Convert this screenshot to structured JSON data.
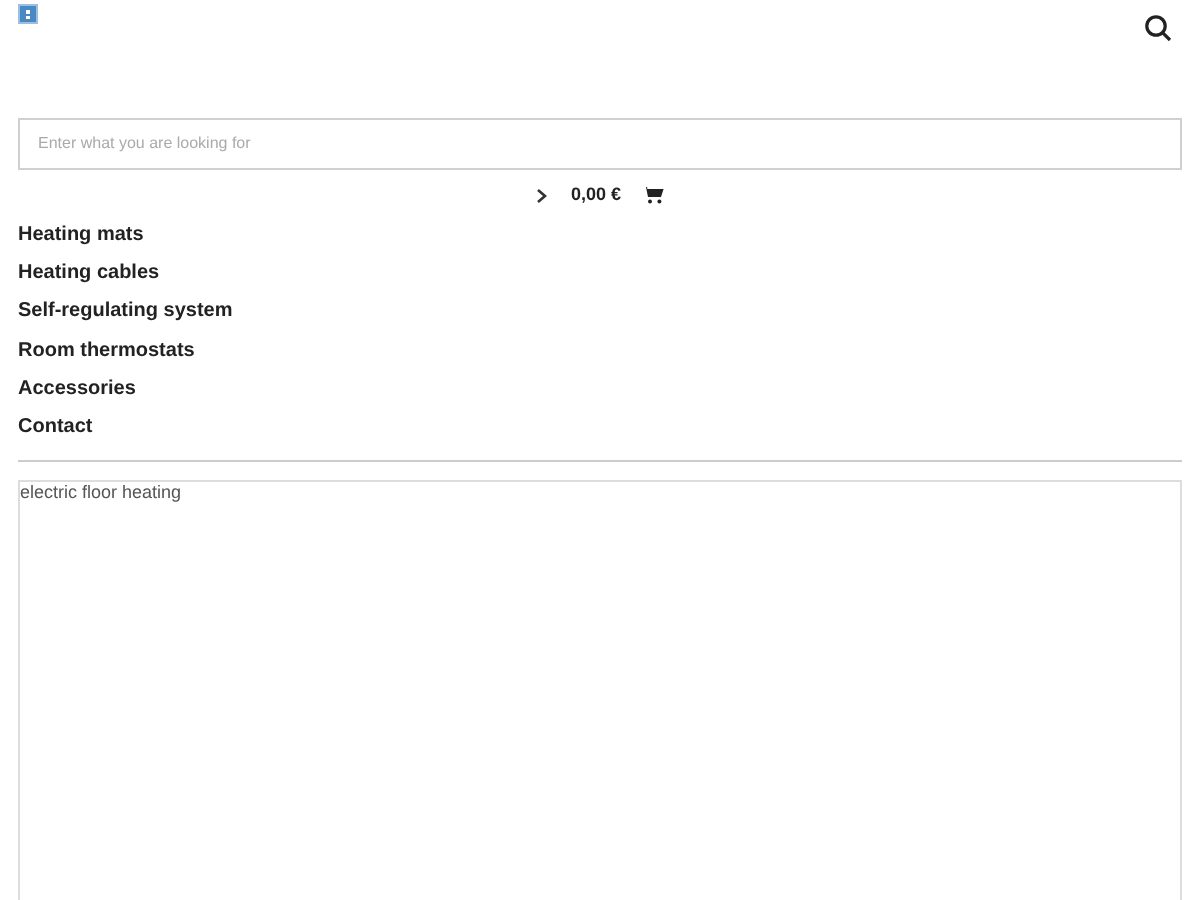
{
  "search": {
    "placeholder": "Enter what you are looking for"
  },
  "cart": {
    "total": "0,00 €"
  },
  "menu": [
    {
      "label": "Heating mats"
    },
    {
      "label": "Heating cables"
    },
    {
      "label": "Self-regulating system"
    },
    {
      "label": "Room thermostats"
    },
    {
      "label": "Accessories"
    },
    {
      "label": "Contact"
    }
  ],
  "banner": {
    "alt_text": "electric floor heating"
  }
}
